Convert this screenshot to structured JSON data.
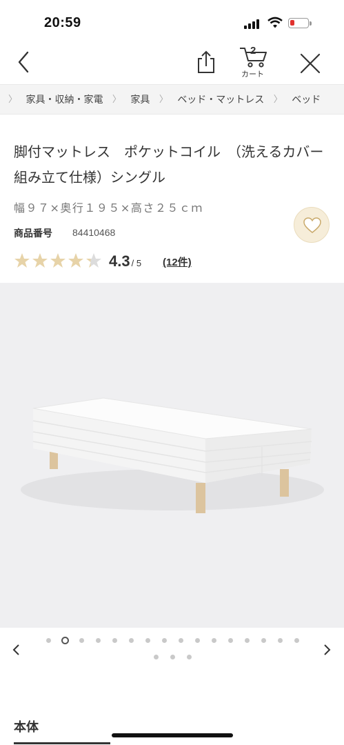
{
  "status_bar": {
    "time": "20:59"
  },
  "nav": {
    "cart_count": "2",
    "cart_label": "カート"
  },
  "breadcrumb": [
    "家具・収納・家電",
    "家具",
    "ベッド・マットレス",
    "ベッド"
  ],
  "product": {
    "title": "脚付マットレス　ポケットコイル　（洗えるカバー　組み立て仕様）シングル",
    "dimensions": "幅９７×奥行１９５×高さ２５ｃｍ",
    "product_number_label": "商品番号",
    "product_number": "84410468",
    "rating": "4.3",
    "rating_out_of": "/ 5",
    "rating_fraction": 0.86,
    "reviews": "(12件)"
  },
  "carousel": {
    "total_images": 19,
    "active_index": 1
  },
  "section": {
    "title": "本体"
  },
  "colors": {
    "star": "#e7d3a8",
    "star_empty": "#dcdcdc",
    "fav_bg": "#f6edd9",
    "battery_low": "#e0312e"
  },
  "icons": [
    "back-icon",
    "share-icon",
    "cart-icon",
    "close-icon",
    "heart-icon",
    "star-icon",
    "chevron-left-icon",
    "chevron-right-icon"
  ]
}
